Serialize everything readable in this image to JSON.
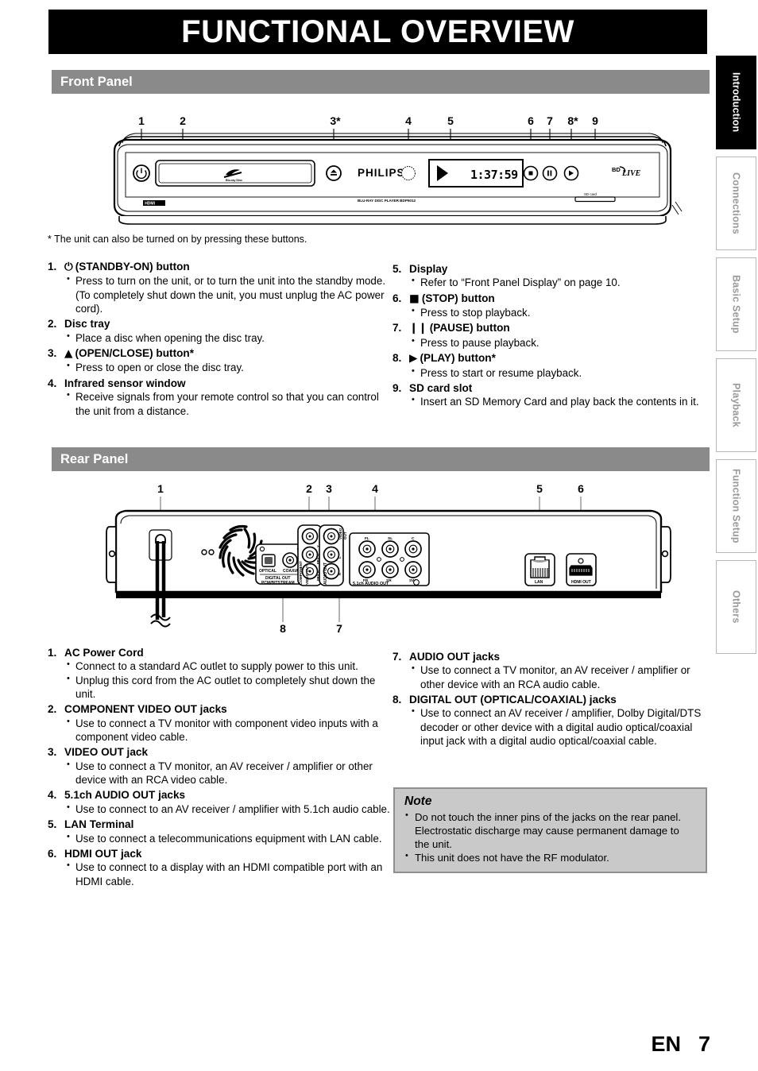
{
  "header": {
    "title": "FUNCTIONAL OVERVIEW"
  },
  "footer": {
    "lang": "EN",
    "page": "7"
  },
  "side_tabs": [
    {
      "label": "Introduction",
      "active": true
    },
    {
      "label": "Connections",
      "active": false
    },
    {
      "label": "Basic Setup",
      "active": false
    },
    {
      "label": "Playback",
      "active": false
    },
    {
      "label": "Function Setup",
      "active": false
    },
    {
      "label": "Others",
      "active": false
    }
  ],
  "front_panel": {
    "section_title": "Front Panel",
    "footnote": "* The unit can also be turned on by pressing these buttons.",
    "diagram": {
      "callouts": [
        "1",
        "2",
        "3*",
        "4",
        "5",
        "6",
        "7",
        "8*",
        "9"
      ],
      "brand": "PHILIPS",
      "model_text": "BLU-RAY DISC PLAYER BDP5012",
      "hdmi_logo": "HDMI",
      "disc_logo": "Blu-ray Disc",
      "display_value": "1:37:59",
      "bdlive_logo": "BD LIVE",
      "sd_card_label": "SD card"
    },
    "items_left": [
      {
        "num": "1.",
        "glyph": "⏻",
        "title": "(STANDBY-ON) button",
        "bullets": [
          "Press to turn on the unit, or to turn the unit into the standby mode. (To completely shut down the unit, you must unplug the AC power cord)."
        ]
      },
      {
        "num": "2.",
        "glyph": "",
        "title": "Disc tray",
        "bullets": [
          "Place a disc when opening the disc tray."
        ]
      },
      {
        "num": "3.",
        "glyph": "▲",
        "title": "(OPEN/CLOSE) button*",
        "bullets": [
          "Press to open or close the disc tray."
        ]
      },
      {
        "num": "4.",
        "glyph": "",
        "title": "Infrared sensor window",
        "bullets": [
          "Receive signals from your remote control so that you can control the unit from a distance."
        ]
      }
    ],
    "items_right": [
      {
        "num": "5.",
        "glyph": "",
        "title": "Display",
        "bullets": [
          "Refer to “Front Panel Display” on page 10."
        ]
      },
      {
        "num": "6.",
        "glyph": "■",
        "title": "(STOP) button",
        "bullets": [
          "Press to stop playback."
        ]
      },
      {
        "num": "7.",
        "glyph": "❙❙",
        "title": "(PAUSE) button",
        "bullets": [
          "Press to pause playback."
        ]
      },
      {
        "num": "8.",
        "glyph": "▶",
        "title": "(PLAY) button*",
        "bullets": [
          "Press to start or resume playback."
        ]
      },
      {
        "num": "9.",
        "glyph": "",
        "title": "SD card slot",
        "bullets": [
          "Insert an SD Memory Card and play back the contents in it."
        ]
      }
    ]
  },
  "rear_panel": {
    "section_title": "Rear Panel",
    "diagram": {
      "callouts_top": [
        "1",
        "2",
        "3",
        "4",
        "5",
        "6"
      ],
      "callouts_bottom": [
        "8",
        "7"
      ],
      "labels": {
        "optical": "OPTICAL",
        "coaxial": "COAXIAL",
        "digital_out": "DIGITAL OUT",
        "pcm_bitstream": "PCM/BITSTREAM",
        "component_video_out": "COMPONENT VIDEO OUT",
        "video_out": "VIDEO OUT",
        "audio_out": "AUDIO OUT",
        "surround_out": "5.1ch AUDIO OUT",
        "ch_fl": "FL",
        "ch_sl": "SL",
        "ch_c": "C",
        "ch_fr": "FR",
        "ch_sr": "SR",
        "ch_sw": "SW",
        "comp_y": "Y",
        "comp_pb": "PB/CB",
        "comp_pr": "PR/CR",
        "audio_l": "L",
        "audio_r": "R",
        "lan": "LAN",
        "hdmi_out": "HDMI OUT"
      }
    },
    "items_left": [
      {
        "num": "1.",
        "glyph": "",
        "title": "AC Power Cord",
        "bullets": [
          "Connect to a standard AC outlet to supply power to this unit.",
          "Unplug this cord from the AC outlet to completely shut down the unit."
        ]
      },
      {
        "num": "2.",
        "glyph": "",
        "title": "COMPONENT VIDEO OUT jacks",
        "bullets": [
          "Use to connect a TV monitor with component video inputs with a component video cable."
        ]
      },
      {
        "num": "3.",
        "glyph": "",
        "title": "VIDEO OUT jack",
        "bullets": [
          "Use to connect a TV monitor, an AV receiver / amplifier or other device with an RCA video cable."
        ]
      },
      {
        "num": "4.",
        "glyph": "",
        "title": "5.1ch AUDIO OUT jacks",
        "bullets": [
          "Use to connect to an AV receiver / amplifier with 5.1ch audio cable."
        ]
      },
      {
        "num": "5.",
        "glyph": "",
        "title": "LAN Terminal",
        "bullets": [
          "Use to connect a telecommunications equipment with LAN cable."
        ]
      },
      {
        "num": "6.",
        "glyph": "",
        "title": "HDMI OUT jack",
        "bullets": [
          "Use to connect to a display with an HDMI compatible port with an HDMI cable."
        ]
      }
    ],
    "items_right": [
      {
        "num": "7.",
        "glyph": "",
        "title": "AUDIO OUT jacks",
        "bullets": [
          "Use to connect a TV monitor, an AV receiver / amplifier or other device with an RCA audio cable."
        ]
      },
      {
        "num": "8.",
        "glyph": "",
        "title": "DIGITAL OUT (OPTICAL/COAXIAL) jacks",
        "bullets": [
          "Use to connect an AV receiver / amplifier, Dolby Digital/DTS decoder or other device with a digital audio optical/coaxial input jack with a digital audio optical/coaxial cable."
        ]
      }
    ],
    "note": {
      "title": "Note",
      "bullets": [
        "Do not touch the inner pins of the jacks on the rear panel. Electrostatic discharge may cause permanent damage to the unit.",
        "This unit does not have the RF modulator."
      ]
    }
  },
  "colors": {
    "title_bar_bg": "#000000",
    "section_bar_bg": "#8a8a8a",
    "note_bg": "#c9c9c9",
    "note_border": "#8f8f8f",
    "tab_inactive_text": "#9a9a9a"
  }
}
